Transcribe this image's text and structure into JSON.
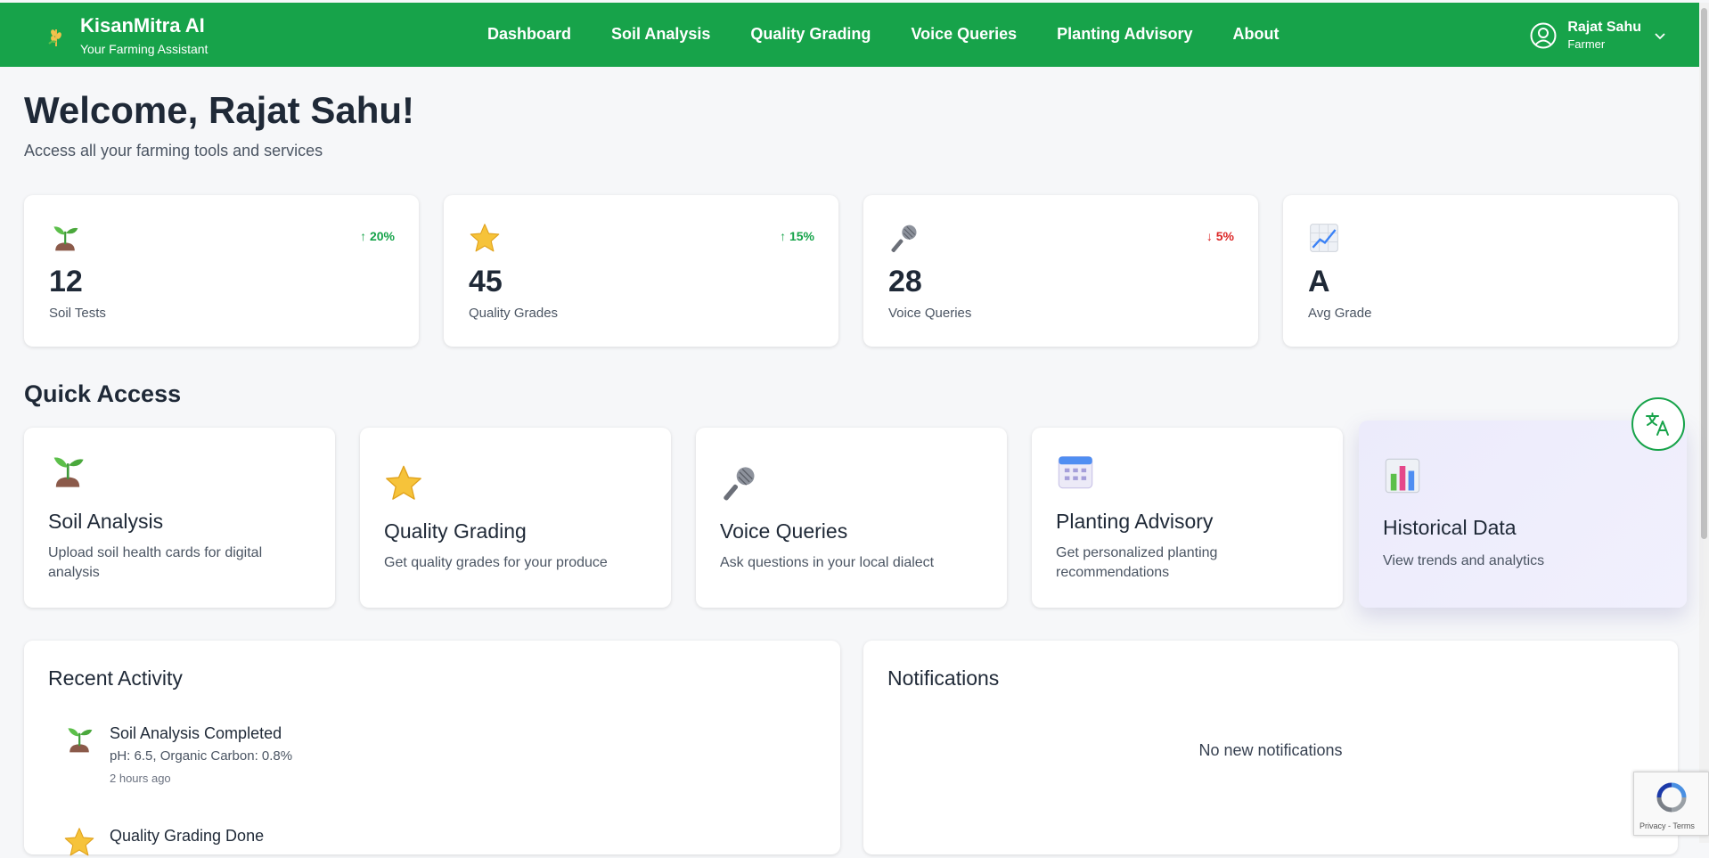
{
  "header": {
    "brand_name": "KisanMitra AI",
    "brand_tagline": "Your Farming Assistant",
    "nav": [
      "Dashboard",
      "Soil Analysis",
      "Quality Grading",
      "Voice Queries",
      "Planting Advisory",
      "About"
    ],
    "user_name": "Rajat Sahu",
    "user_role": "Farmer",
    "accent": "#17a34a"
  },
  "welcome": {
    "title": "Welcome, Rajat Sahu!",
    "subtitle": "Access all your farming tools and services"
  },
  "stats": [
    {
      "icon": "seedling-icon",
      "value": "12",
      "label": "Soil Tests",
      "trend": "↑ 20%",
      "trend_dir": "up"
    },
    {
      "icon": "star-icon",
      "value": "45",
      "label": "Quality Grades",
      "trend": "↑ 15%",
      "trend_dir": "up"
    },
    {
      "icon": "microphone-icon",
      "value": "28",
      "label": "Voice Queries",
      "trend": "↓ 5%",
      "trend_dir": "down"
    },
    {
      "icon": "chart-increasing-icon",
      "value": "A",
      "label": "Avg Grade",
      "trend": "",
      "trend_dir": ""
    }
  ],
  "quick_access": {
    "title": "Quick Access",
    "items": [
      {
        "icon": "seedling-icon",
        "title": "Soil Analysis",
        "desc": "Upload soil health cards for digital analysis"
      },
      {
        "icon": "star-icon",
        "title": "Quality Grading",
        "desc": "Get quality grades for your produce"
      },
      {
        "icon": "microphone-icon",
        "title": "Voice Queries",
        "desc": "Ask questions in your local dialect"
      },
      {
        "icon": "calendar-icon",
        "title": "Planting Advisory",
        "desc": "Get personalized planting recommendations"
      },
      {
        "icon": "bar-chart-icon",
        "title": "Historical Data",
        "desc": "View trends and analytics"
      }
    ]
  },
  "recent_activity": {
    "title": "Recent Activity",
    "items": [
      {
        "icon": "seedling-icon",
        "title": "Soil Analysis Completed",
        "desc": "pH: 6.5, Organic Carbon: 0.8%",
        "time": "2 hours ago"
      },
      {
        "icon": "star-icon",
        "title": "Quality Grading Done",
        "desc": "",
        "time": ""
      }
    ]
  },
  "notifications": {
    "title": "Notifications",
    "empty_text": "No new notifications"
  },
  "recaptcha": {
    "links": "Privacy - Terms"
  }
}
